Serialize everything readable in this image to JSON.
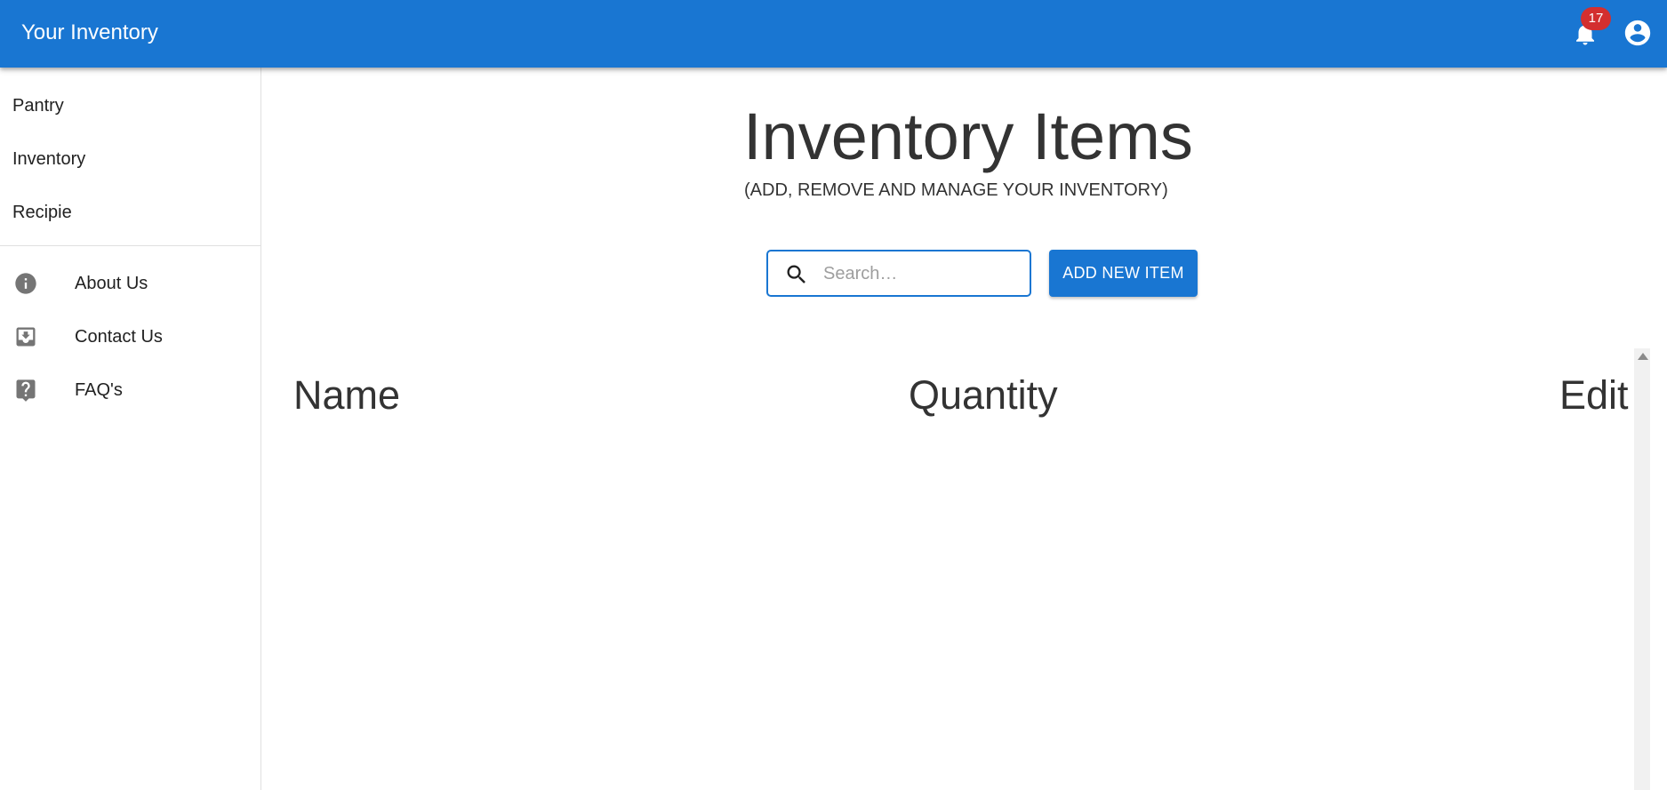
{
  "appbar": {
    "title": "Your Inventory",
    "notifications": {
      "icon": "bell-icon",
      "count": "17"
    },
    "account": {
      "icon": "account-circle-icon"
    },
    "color": "#1976d2"
  },
  "sidebar": {
    "primary_items": [
      {
        "label": "Pantry"
      },
      {
        "label": "Inventory"
      },
      {
        "label": "Recipie"
      }
    ],
    "secondary_items": [
      {
        "label": "About Us",
        "icon": "info-icon"
      },
      {
        "label": "Contact Us",
        "icon": "inbox-download-icon"
      },
      {
        "label": "FAQ's",
        "icon": "help-question-icon"
      }
    ]
  },
  "main": {
    "title": "Inventory Items",
    "subtitle": "(ADD, REMOVE AND MANAGE YOUR INVENTORY)",
    "search": {
      "placeholder": "Search…",
      "value": "",
      "icon": "search-icon"
    },
    "add_button_label": "ADD NEW ITEM",
    "table": {
      "columns": [
        "Name",
        "Quantity",
        "Edit"
      ],
      "rows": []
    }
  },
  "colors": {
    "primary": "#1976d2",
    "badge": "#d32f2f",
    "heading_text": "#333333"
  }
}
